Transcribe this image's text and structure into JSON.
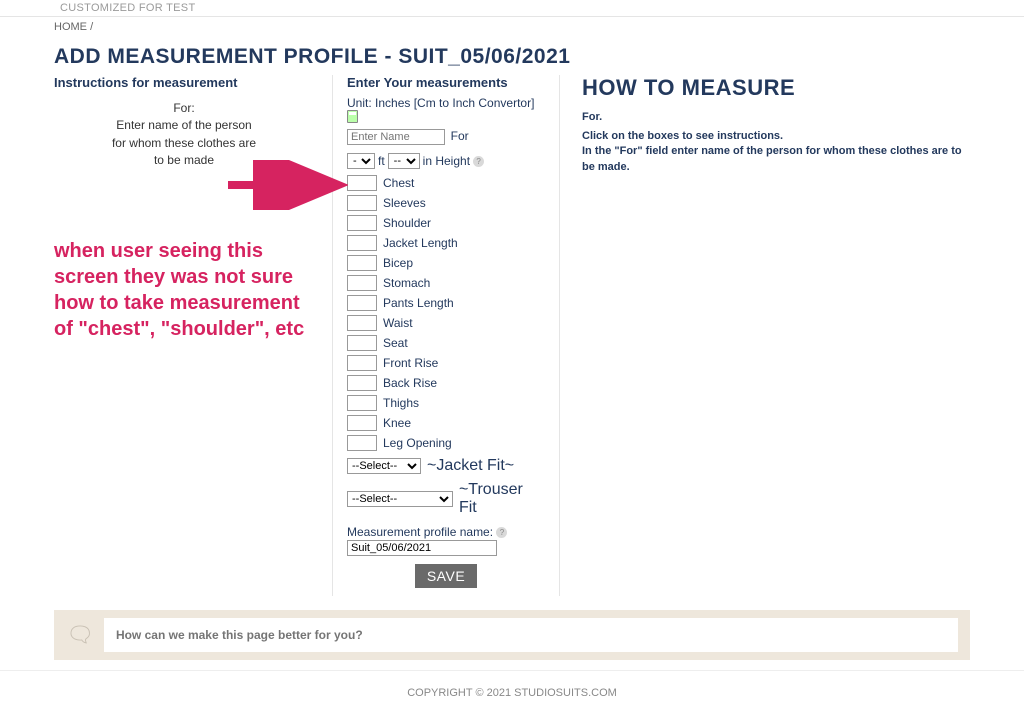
{
  "topbar": {
    "text": "CUSTOMIZED FOR TEST"
  },
  "breadcrumb": {
    "home": "HOME",
    "sep": "/"
  },
  "page_title": "ADD MEASUREMENT PROFILE - SUIT_05/06/2021",
  "left": {
    "heading": "Instructions for measurement",
    "line1": "For:",
    "line2": "Enter name of the person",
    "line3": "for whom these clothes are",
    "line4": "to be made"
  },
  "mid": {
    "heading": "Enter Your measurements",
    "unit_prefix": "Unit: Inches  ",
    "convertor_link": "[Cm to Inch Convertor]",
    "name_placeholder": "Enter Name",
    "for_label": "For",
    "height": {
      "ft_option": "-",
      "ft_label": "ft",
      "in_option": "--",
      "in_label": "in Height"
    },
    "fields": [
      "Chest",
      "Sleeves",
      "Shoulder",
      "Jacket Length",
      "Bicep",
      "Stomach",
      "Pants Length",
      "Waist",
      "Seat",
      "Front Rise",
      "Back Rise",
      "Thighs",
      "Knee",
      "Leg Opening"
    ],
    "fit": {
      "select_option": "--Select--",
      "jacket_label": "~Jacket Fit~",
      "trouser_select": "--Select--",
      "trouser_label": "~Trouser Fit"
    },
    "profile_name_label": "Measurement profile name:",
    "profile_name_value": "Suit_05/06/2021",
    "save": "SAVE"
  },
  "right": {
    "title": "HOW TO MEASURE",
    "sub": "For.",
    "body1": "Click on the boxes to see instructions.",
    "body2": "In the \"For\" field enter name of the person for whom these clothes are to be made."
  },
  "annotation": {
    "line1": "when user seeing this",
    "line2": "screen they was not sure",
    "line3": "how to take measurement",
    "line4": "of \"chest\", \"shoulder\", etc"
  },
  "feedback": {
    "placeholder": "How can we make this page better for you?"
  },
  "footer": {
    "text": "COPYRIGHT © 2021  STUDIOSUITS.COM"
  }
}
